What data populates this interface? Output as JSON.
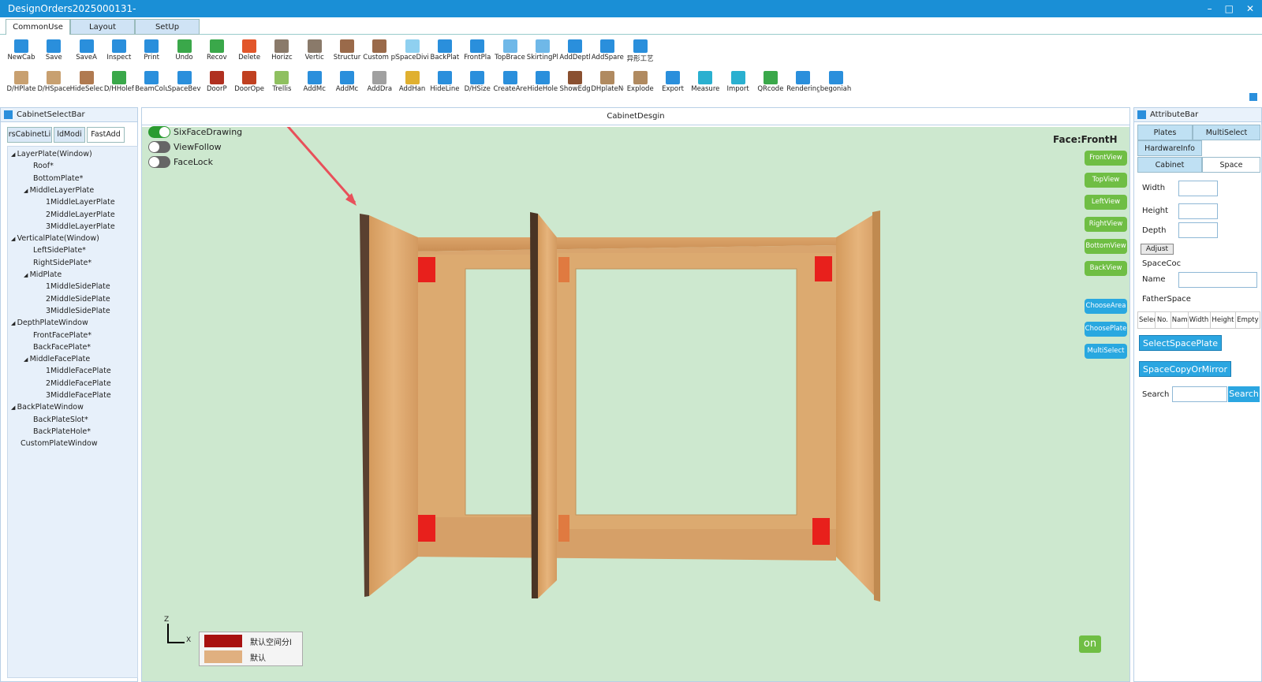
{
  "window": {
    "title": "DesignOrders2025000131-",
    "controls": [
      "–",
      "□",
      "✕"
    ]
  },
  "ribbon_tabs": [
    {
      "label": "CommonUse",
      "active": true
    },
    {
      "label": "Layout"
    },
    {
      "label": "SetUp"
    }
  ],
  "toolbar_row1": [
    {
      "label": "NewCab",
      "icon": "new-cabinet-icon",
      "color": "#2a8fdc"
    },
    {
      "label": "Save",
      "icon": "save-icon",
      "color": "#2a8fdc"
    },
    {
      "label": "SaveA",
      "icon": "save-as-icon",
      "color": "#2a8fdc"
    },
    {
      "label": "Inspect",
      "icon": "inspect-icon",
      "color": "#2a8fdc"
    },
    {
      "label": "Print",
      "icon": "print-icon",
      "color": "#2a8fdc"
    },
    {
      "label": "Undo",
      "icon": "undo-icon",
      "color": "#3aa84a"
    },
    {
      "label": "Recov",
      "icon": "redo-icon",
      "color": "#3aa84a"
    },
    {
      "label": "Delete",
      "icon": "delete-icon",
      "color": "#e2562a"
    },
    {
      "label": "Horizc",
      "icon": "horizontal-icon",
      "color": "#8a7a6a"
    },
    {
      "label": "Vertic",
      "icon": "vertical-icon",
      "color": "#8a7a6a"
    },
    {
      "label": "Structur",
      "icon": "structure-icon",
      "color": "#9a6a4a"
    },
    {
      "label": "Custom pl",
      "icon": "custom-plate-icon",
      "color": "#9a6a4a"
    },
    {
      "label": "SpaceDivic",
      "icon": "space-divide-icon",
      "color": "#8fd0f0"
    },
    {
      "label": "BackPlat",
      "icon": "back-plate-icon",
      "color": "#2a8fdc"
    },
    {
      "label": "FrontPla",
      "icon": "front-plate-icon",
      "color": "#2a8fdc"
    },
    {
      "label": "TopBrace",
      "icon": "top-brace-icon",
      "color": "#6fb8e8"
    },
    {
      "label": "SkirtingPl",
      "icon": "skirting-plate-icon",
      "color": "#6fb8e8"
    },
    {
      "label": "AddDeptl",
      "icon": "add-depth-icon",
      "color": "#2a8fdc"
    },
    {
      "label": "AddSpare",
      "icon": "add-spare-icon",
      "color": "#2a8fdc"
    },
    {
      "label": "异形工艺",
      "icon": "special-process-icon",
      "color": "#2a8fdc"
    }
  ],
  "toolbar_row2": [
    {
      "label": "D/HPlate",
      "icon": "dh-plate-icon",
      "color": "#c8a070"
    },
    {
      "label": "D/HSpace",
      "icon": "dh-space-icon",
      "color": "#c8a070"
    },
    {
      "label": "HideSelec",
      "icon": "hide-select-icon",
      "color": "#b07a50"
    },
    {
      "label": "D/HHolef",
      "icon": "dh-hole-icon",
      "color": "#3aa84a"
    },
    {
      "label": "BeamColu",
      "icon": "beam-column-icon",
      "color": "#2a8fdc"
    },
    {
      "label": "SpaceBev",
      "icon": "space-bevel-icon",
      "color": "#2a8fdc"
    },
    {
      "label": "DoorP",
      "icon": "door-panel-icon",
      "color": "#b03020"
    },
    {
      "label": "DoorOpe",
      "icon": "door-open-icon",
      "color": "#c04020"
    },
    {
      "label": "Trellis",
      "icon": "trellis-icon",
      "color": "#8fc060"
    },
    {
      "label": "AddMc",
      "icon": "add-module-icon",
      "color": "#2a8fdc"
    },
    {
      "label": "AddMc",
      "icon": "add-module-2-icon",
      "color": "#2a8fdc"
    },
    {
      "label": "AddDra",
      "icon": "add-drawer-icon",
      "color": "#a0a0a0"
    },
    {
      "label": "AddHan",
      "icon": "add-handle-icon",
      "color": "#e0b030"
    },
    {
      "label": "HideLine",
      "icon": "hide-line-icon",
      "color": "#2a8fdc"
    },
    {
      "label": "D/HSize",
      "icon": "dh-size-icon",
      "color": "#2a8fdc"
    },
    {
      "label": "CreateAre",
      "icon": "create-area-icon",
      "color": "#2a8fdc"
    },
    {
      "label": "HideHole",
      "icon": "hide-hole-icon",
      "color": "#2a8fdc"
    },
    {
      "label": "ShowEdg",
      "icon": "show-edge-icon",
      "color": "#8a5030"
    },
    {
      "label": "DHplateNo",
      "icon": "dh-plate-no-icon",
      "color": "#b08a60"
    },
    {
      "label": "Explode",
      "icon": "explode-icon",
      "color": "#b08a60"
    },
    {
      "label": "Export",
      "icon": "export-icon",
      "color": "#2a8fdc"
    },
    {
      "label": "Measure",
      "icon": "measure-icon",
      "color": "#2ab0d0"
    },
    {
      "label": "Import",
      "icon": "import-icon",
      "color": "#2ab0d0"
    },
    {
      "label": "QRcode",
      "icon": "qrcode-icon",
      "color": "#3aa84a"
    },
    {
      "label": "Rendering",
      "icon": "rendering-icon",
      "color": "#2a8fdc"
    },
    {
      "label": "begoniah",
      "icon": "begoniah-icon",
      "color": "#2a8fdc"
    }
  ],
  "left_panel": {
    "title": "CabinetSelectBar",
    "tabs": [
      {
        "label": "rsCabinetLi"
      },
      {
        "label": "ldModi"
      },
      {
        "label": "FastAdd",
        "active": true
      }
    ],
    "tree": [
      {
        "label": "LayerPlate(Window)",
        "level": 0,
        "expanded": true
      },
      {
        "label": "Roof*",
        "level": 1
      },
      {
        "label": "BottomPlate*",
        "level": 1
      },
      {
        "label": "MiddleLayerPlate",
        "level": 1,
        "expanded": true
      },
      {
        "label": "1MiddleLayerPlate",
        "level": 2
      },
      {
        "label": "2MiddleLayerPlate",
        "level": 2
      },
      {
        "label": "3MiddleLayerPlate",
        "level": 2
      },
      {
        "label": "VerticalPlate(Window)",
        "level": 0,
        "expanded": true
      },
      {
        "label": "LeftSidePlate*",
        "level": 1
      },
      {
        "label": "RightSidePlate*",
        "level": 1
      },
      {
        "label": "MidPlate",
        "level": 1,
        "expanded": true
      },
      {
        "label": "1MiddleSidePlate",
        "level": 2
      },
      {
        "label": "2MiddleSidePlate",
        "level": 2
      },
      {
        "label": "3MiddleSidePlate",
        "level": 2
      },
      {
        "label": "DepthPlateWindow",
        "level": 0,
        "expanded": true
      },
      {
        "label": "FrontFacePlate*",
        "level": 1
      },
      {
        "label": "BackFacePlate*",
        "level": 1
      },
      {
        "label": "MiddleFacePlate",
        "level": 1,
        "expanded": true
      },
      {
        "label": "1MiddleFacePlate",
        "level": 2
      },
      {
        "label": "2MiddleFacePlate",
        "level": 2
      },
      {
        "label": "3MiddleFacePlate",
        "level": 2
      },
      {
        "label": "BackPlateWindow",
        "level": 0,
        "expanded": true
      },
      {
        "label": "BackPlateSlot*",
        "level": 1
      },
      {
        "label": "BackPlateHole*",
        "level": 1
      },
      {
        "label": "CustomPlateWindow",
        "level": 0
      }
    ]
  },
  "canvas": {
    "title": "CabinetDesgin",
    "face_label": "Face:FrontH",
    "toggles": [
      {
        "label": "SixFaceDrawing",
        "on": true
      },
      {
        "label": "ViewFollow",
        "on": false
      },
      {
        "label": "FaceLock",
        "on": false
      }
    ],
    "view_buttons": [
      "FrontView",
      "TopView",
      "LeftView",
      "RightView",
      "BottomView",
      "BackView"
    ],
    "action_buttons": [
      "ChooseArea",
      "ChoosePlate",
      "MultiSelect"
    ],
    "axis": {
      "z": "Z",
      "x": "X"
    },
    "legend": [
      {
        "label": "默认空间分l",
        "color": "#a81010"
      },
      {
        "label": "默认",
        "color": "#e0b080"
      }
    ],
    "logo": "on",
    "colors": {
      "background": "#cde8cf",
      "wood": "#dba86e",
      "hardware": "#e8201c"
    }
  },
  "right_panel": {
    "title": "AttributeBar",
    "tabs_row1": [
      {
        "label": "Plates"
      },
      {
        "label": "MultiSelect"
      }
    ],
    "tabs_row2": [
      {
        "label": "HardwareInfo"
      }
    ],
    "tabs_row3": [
      {
        "label": "Cabinet"
      },
      {
        "label": "Space",
        "active": true
      }
    ],
    "fields": {
      "width": "Width",
      "height": "Height",
      "depth": "Depth",
      "adjust": "Adjust",
      "space_coc": "SpaceCoc",
      "name": "Name",
      "father_space": "FatherSpace"
    },
    "table_headers": [
      "Selec",
      "No.",
      "Nam",
      "Width",
      "Height",
      "Empty"
    ],
    "select_space_plate": "SelectSpacePlate",
    "space_copy_mirror": "SpaceCopyOrMirror",
    "search_label": "Search",
    "search_button": "Search",
    "search_value": ""
  }
}
